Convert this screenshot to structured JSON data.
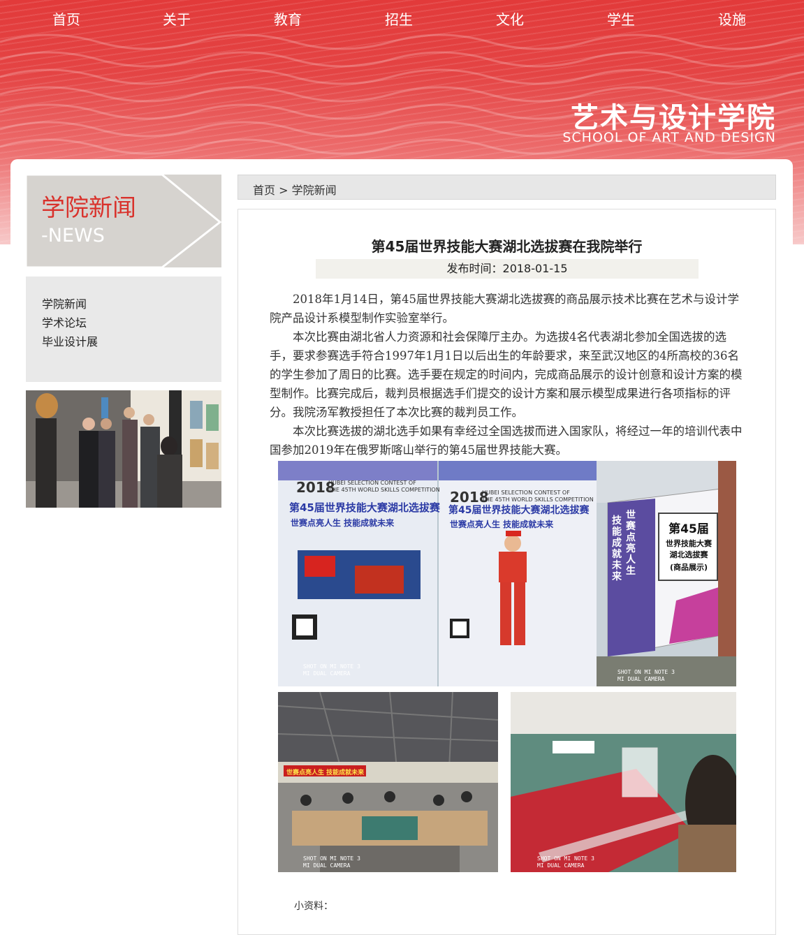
{
  "nav": {
    "items": [
      "首页",
      "关于",
      "教育",
      "招生",
      "文化",
      "学生",
      "设施"
    ]
  },
  "brand": {
    "name_cn": "艺术与设计学院",
    "name_en": "SCHOOL OF ART AND DESIGN"
  },
  "sidebar": {
    "section_title_cn": "学院新闻",
    "section_title_en": "-NEWS",
    "menu": [
      "学院新闻",
      "学术论坛",
      "毕业设计展"
    ]
  },
  "breadcrumb": {
    "home": "首页",
    "separator": ">",
    "current": "学院新闻"
  },
  "article": {
    "title": "第45届世界技能大赛湖北选拔赛在我院举行",
    "date_label": "发布时间：",
    "date": "2018-01-15",
    "paragraphs": [
      "2018年1月14日，第45届世界技能大赛湖北选拔赛的商品展示技术比赛在艺术与设计学院产品设计系模型制作实验室举行。",
      "本次比赛由湖北省人力资源和社会保障厅主办。为选拔4名代表湖北参加全国选拔的选手，要求参赛选手符合1997年1月1日以后出生的年龄要求，来至武汉地区的4所高校的36名的学生参加了周日的比赛。选手要在规定的时间内，完成商品展示的设计创意和设计方案的模型制作。比赛完成后，裁判员根据选手们提交的设计方案和展示模型成果进行各项指标的评分。我院汤军教授担任了本次比赛的裁判员工作。",
      "本次比赛选拔的湖北选手如果有幸经过全国选拔而进入国家队，将经过一年的培训代表中国参加2019年在俄罗斯喀山举行的第45届世界技能大赛。"
    ],
    "note_label": "小资料："
  },
  "photos": {
    "poster_year": "2018",
    "poster_en_1": "HUBEI SELECTION CONTEST OF",
    "poster_en_2": "THE 45TH WORLD SKILLS COMPETITION",
    "poster_title": "第45届世界技能大赛湖北选拔赛",
    "poster_slogan": "世赛点亮人生 技能成就未来",
    "board_title_1": "第45届",
    "board_title_2": "世界技能大赛",
    "board_title_3": "湖北选拔赛",
    "board_title_4": "(商品展示)",
    "board_vertical_1": "世赛点亮人生",
    "board_vertical_2": "技能成就未来",
    "banner_in_hall": "世赛点亮人生 技能成就未来",
    "watermark_1": "SHOT ON MI NOTE 3",
    "watermark_2": "MI DUAL CAMERA"
  },
  "colors": {
    "brand_red": "#e23a3a",
    "news_red": "#d9322c"
  }
}
